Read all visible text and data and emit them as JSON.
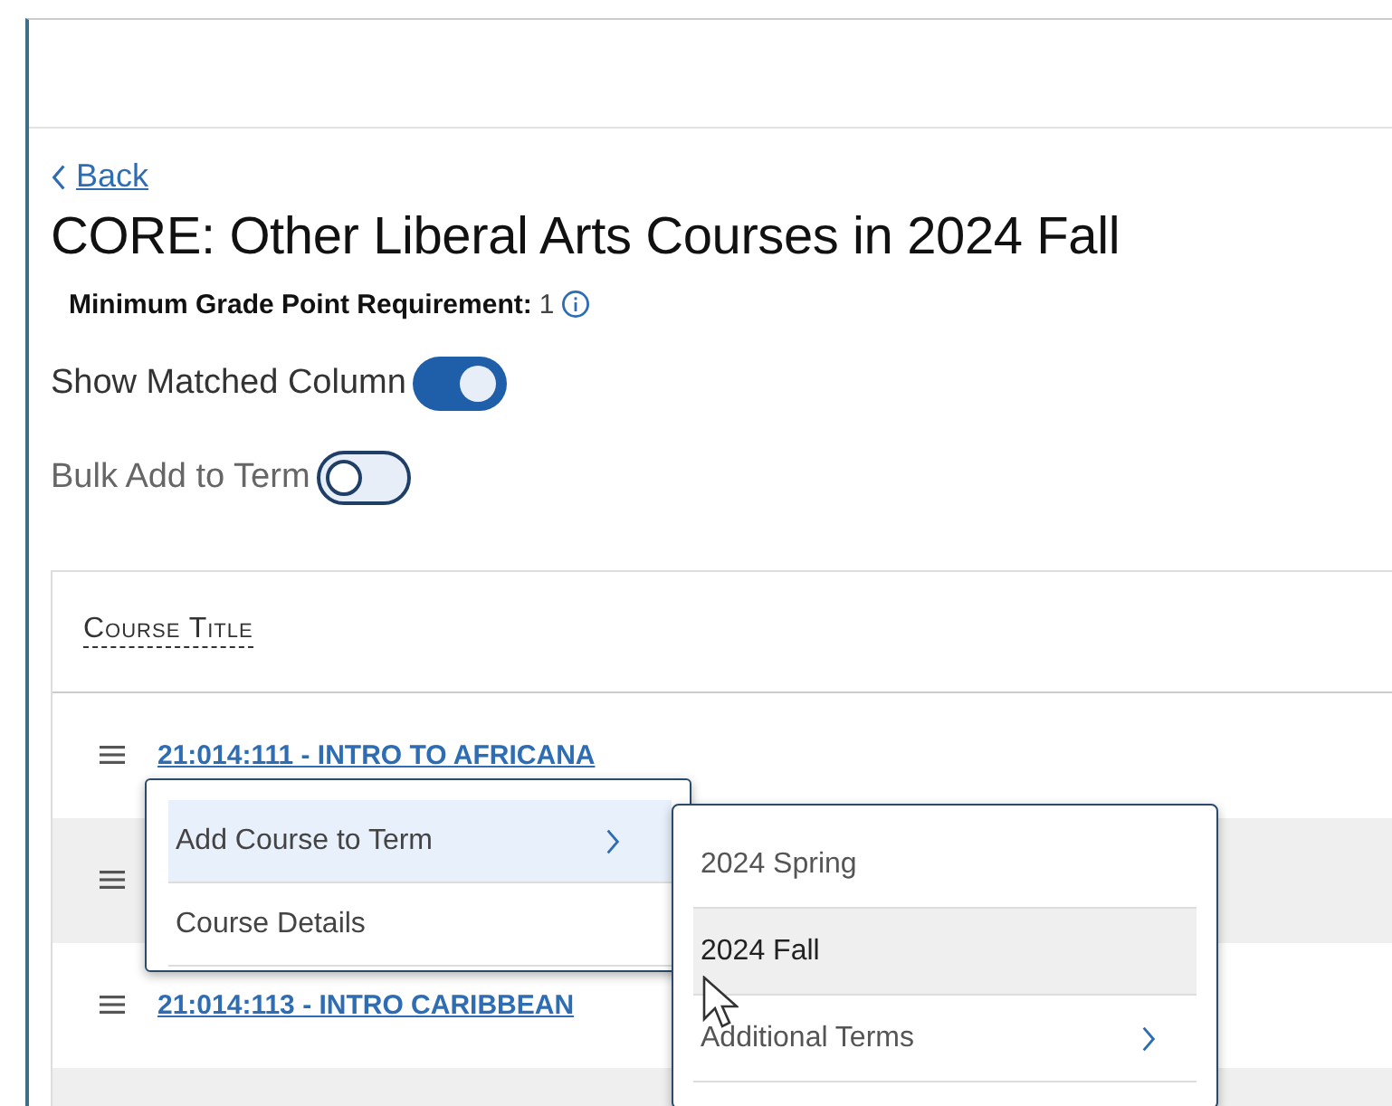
{
  "back_link": "Back",
  "title": "CORE: Other Liberal Arts Courses in 2024 Fall",
  "requirement": {
    "label": "Minimum Grade Point Requirement:",
    "value": "1"
  },
  "toggles": [
    {
      "label": "Show Matched Column",
      "on": true
    },
    {
      "label": "Bulk Add to Term",
      "on": false
    }
  ],
  "table": {
    "columns": [
      "Course Title"
    ],
    "rows": [
      {
        "title": "21:014:111 - INTRO TO AFRICANA",
        "menu_icon": true
      },
      {
        "menu_icon": true
      },
      {
        "title": "21:014:113 - INTRO CARIBBEAN",
        "menu_icon": true
      },
      {
        "menu_icon": false
      }
    ]
  },
  "context_menu": {
    "items": [
      {
        "label": "Add Course to Term",
        "selected": true,
        "has_submenu": true
      },
      {
        "label": "Course Details",
        "selected": false,
        "has_submenu": false
      }
    ]
  },
  "submenu": {
    "items": [
      {
        "label": "2024 Spring",
        "selected": false,
        "has_submenu": false
      },
      {
        "label": "2024 Fall",
        "selected": true,
        "has_submenu": false
      },
      {
        "label": "Additional Terms",
        "selected": false,
        "has_submenu": true
      }
    ]
  }
}
